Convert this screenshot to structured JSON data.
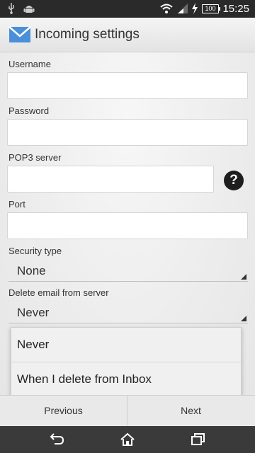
{
  "status_bar": {
    "time": "15:25",
    "battery": "100",
    "icons": [
      "usb-icon",
      "android-icon",
      "wifi-icon",
      "signal-icon",
      "charging-icon",
      "battery-icon"
    ]
  },
  "header": {
    "title": "Incoming settings",
    "app_icon": "envelope-icon"
  },
  "form": {
    "username_label": "Username",
    "username_value": "",
    "password_label": "Password",
    "password_value": "",
    "pop3_label": "POP3 server",
    "pop3_value": "",
    "help_symbol": "?",
    "port_label": "Port",
    "port_value": "",
    "security_label": "Security type",
    "security_value": "None",
    "delete_label": "Delete email from server",
    "delete_value": "Never"
  },
  "dropdown": {
    "options": [
      "Never",
      "When I delete from Inbox"
    ]
  },
  "buttons": {
    "previous": "Previous",
    "next": "Next"
  },
  "navigation_bar": {
    "icons": [
      "back-icon",
      "home-icon",
      "recent-apps-icon"
    ]
  },
  "colors": {
    "status_bar": "#2a2a2a",
    "nav_bar": "#3a3a3a",
    "envelope_blue": "#4a8fd9"
  }
}
